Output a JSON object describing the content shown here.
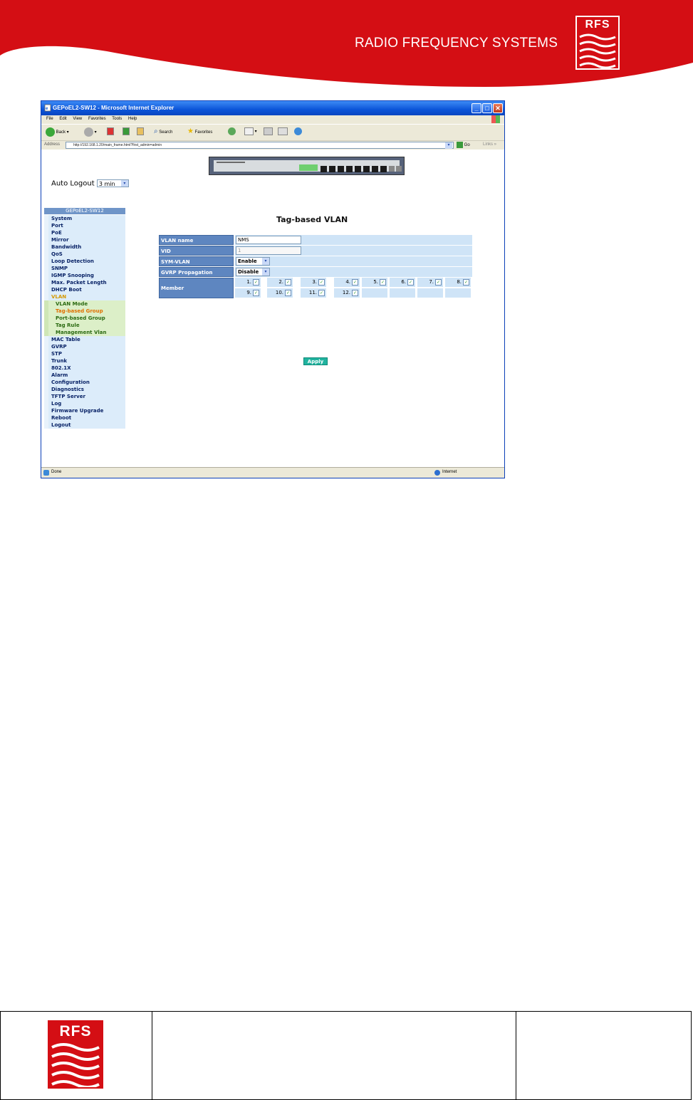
{
  "header": {
    "brand": "RADIO FREQUENCY SYSTEMS",
    "logo_text": "RFS",
    "color": "#d40e14"
  },
  "browser": {
    "title": "GEPoEL2-SW12 - Microsoft Internet Explorer",
    "menu": [
      "File",
      "Edit",
      "View",
      "Favorites",
      "Tools",
      "Help"
    ],
    "toolbar": {
      "back": "Back",
      "search": "Search",
      "favorites": "Favorites"
    },
    "address_label": "Address",
    "url": "http://192.168.1.20/main_frame.html?first_admin=admin",
    "go": "Go",
    "links": "Links",
    "status_left": "Done",
    "status_right": "Internet"
  },
  "auto_logout": {
    "label": "Auto Logout",
    "value": "3 min"
  },
  "nav": {
    "title": "GEPoEL2-SW12",
    "items_top": [
      "System",
      "Port",
      "PoE",
      "Mirror",
      "Bandwidth",
      "QoS",
      "Loop Detection",
      "SNMP",
      "IGMP Snooping",
      "Max. Packet Length",
      "DHCP Boot"
    ],
    "active": "VLAN",
    "sub": [
      "VLAN Mode",
      "Tag-based Group",
      "Port-based Group",
      "Tag Rule",
      "Management Vlan"
    ],
    "items_bottom": [
      "MAC Table",
      "GVRP",
      "STP",
      "Trunk",
      "802.1X",
      "Alarm",
      "Configuration",
      "Diagnostics",
      "TFTP Server",
      "Log",
      "Firmware Upgrade",
      "Reboot",
      "Logout"
    ]
  },
  "page": {
    "heading": "Tag-based VLAN",
    "vlan_name_label": "VLAN name",
    "vlan_name_value": "NMS",
    "vid_label": "VID",
    "vid_value": "1",
    "sym_label": "SYM-VLAN",
    "sym_value": "Enable",
    "gvrp_label": "GVRP Propagation",
    "gvrp_value": "Disable",
    "member_label": "Member",
    "members": [
      "1.",
      "2.",
      "3.",
      "4.",
      "5.",
      "6.",
      "7.",
      "8.",
      "9.",
      "10.",
      "11.",
      "12."
    ],
    "apply": "Apply"
  }
}
